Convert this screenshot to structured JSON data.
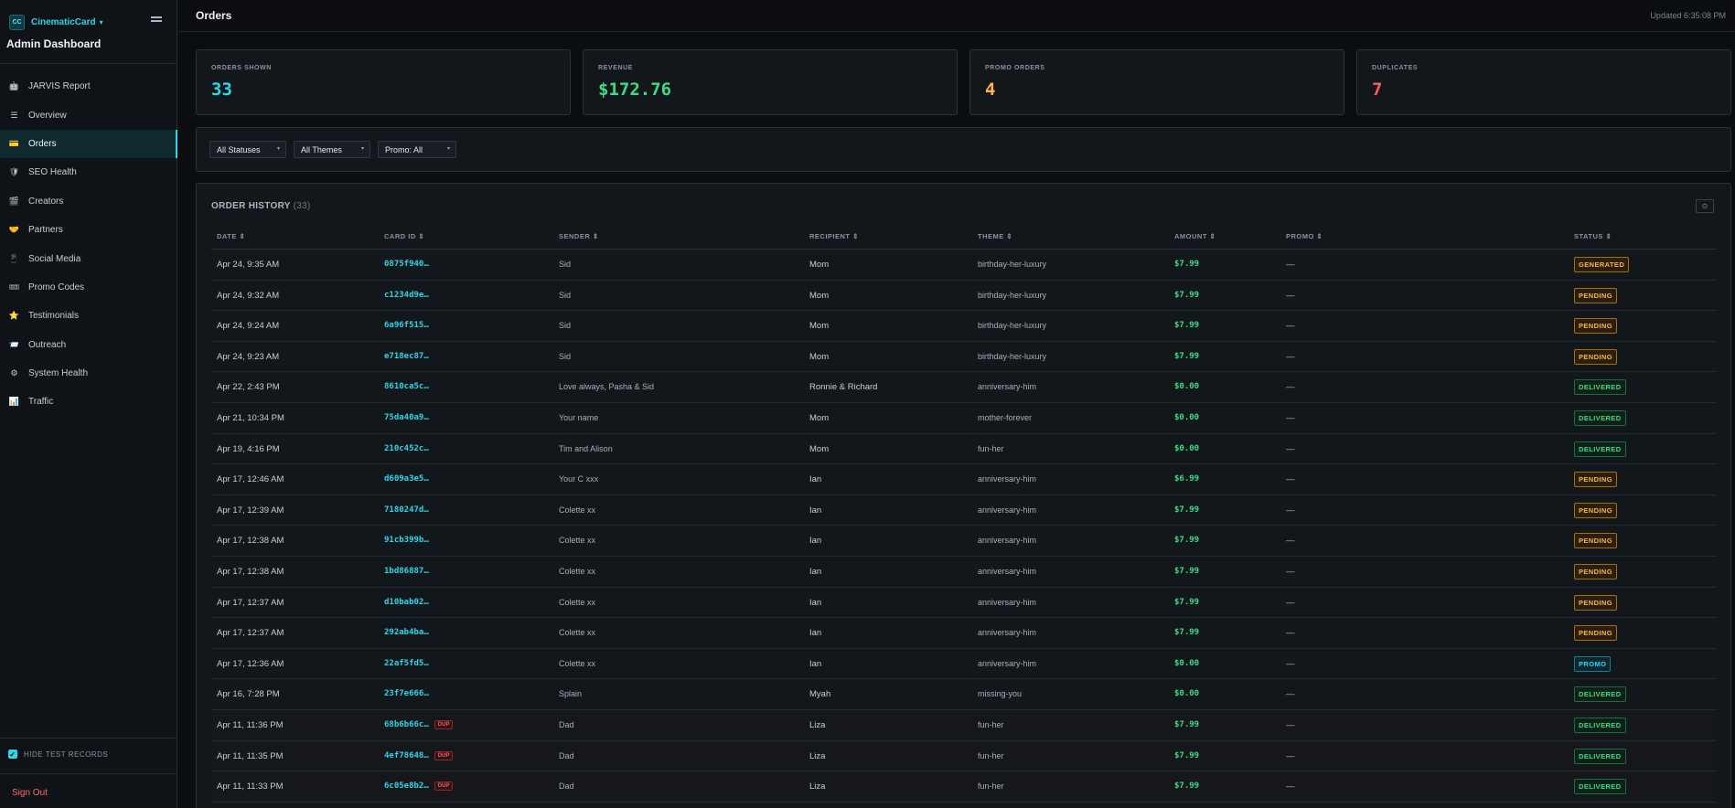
{
  "app": {
    "logo_text": "CC",
    "brand": "CinematicCard",
    "brand_caret": "▾",
    "subtitle": "Admin Dashboard"
  },
  "sidebar": {
    "items": [
      {
        "label": "JARVIS Report",
        "icon": "🤖",
        "icon_name": "robot-icon",
        "active": false
      },
      {
        "label": "Overview",
        "icon": "☰",
        "icon_name": "list-icon",
        "active": false
      },
      {
        "label": "Orders",
        "icon": "💳",
        "icon_name": "card-icon",
        "active": true
      },
      {
        "label": "SEO Health",
        "icon": "🛡",
        "icon_name": "shield-icon",
        "active": false
      },
      {
        "label": "Creators",
        "icon": "🎬",
        "icon_name": "clapper-icon",
        "active": false
      },
      {
        "label": "Partners",
        "icon": "🤝",
        "icon_name": "handshake-icon",
        "active": false
      },
      {
        "label": "Social Media",
        "icon": "📱",
        "icon_name": "phone-icon",
        "active": false
      },
      {
        "label": "Promo Codes",
        "icon": "🎟",
        "icon_name": "ticket-icon",
        "active": false
      },
      {
        "label": "Testimonials",
        "icon": "⭐",
        "icon_name": "star-icon",
        "active": false
      },
      {
        "label": "Outreach",
        "icon": "📨",
        "icon_name": "envelope-icon",
        "active": false
      },
      {
        "label": "System Health",
        "icon": "⚙",
        "icon_name": "gear-icon",
        "active": false
      },
      {
        "label": "Traffic",
        "icon": "📊",
        "icon_name": "chart-icon",
        "active": false
      }
    ],
    "hide_test_label": "HIDE TEST RECORDS",
    "hide_test_checked": true,
    "sign_out": "Sign Out"
  },
  "header": {
    "title": "Orders",
    "updated": "Updated 6:35:08 PM"
  },
  "stats": [
    {
      "label": "ORDERS SHOWN",
      "value": "33",
      "color": "#2fd6e8"
    },
    {
      "label": "REVENUE",
      "value": "$172.76",
      "color": "#3ddc84"
    },
    {
      "label": "PROMO ORDERS",
      "value": "4",
      "color": "#ffb347"
    },
    {
      "label": "DUPLICATES",
      "value": "7",
      "color": "#ff5a5a"
    }
  ],
  "filters": {
    "status": "All Statuses",
    "theme": "All Themes",
    "promo": "Promo: All"
  },
  "order_history": {
    "title": "ORDER HISTORY",
    "count": "(33)",
    "columns": [
      "DATE ⇕",
      "CARD ID ⇕",
      "SENDER ⇕",
      "RECIPIENT ⇕",
      "THEME ⇕",
      "AMOUNT ⇕",
      "PROMO ⇕",
      "STATUS ⇕"
    ],
    "dup_label": "DUP",
    "rows": [
      {
        "date": "Apr 24, 9:35 AM",
        "card": "0875f940…",
        "sender": "Sid",
        "recipient": "Mom",
        "theme": "birthday-her-luxury",
        "amount": "$7.99",
        "promo": "—",
        "status": "GENERATED",
        "dup": false
      },
      {
        "date": "Apr 24, 9:32 AM",
        "card": "c1234d9e…",
        "sender": "Sid",
        "recipient": "Mom",
        "theme": "birthday-her-luxury",
        "amount": "$7.99",
        "promo": "—",
        "status": "PENDING",
        "dup": false
      },
      {
        "date": "Apr 24, 9:24 AM",
        "card": "6a96f515…",
        "sender": "Sid",
        "recipient": "Mom",
        "theme": "birthday-her-luxury",
        "amount": "$7.99",
        "promo": "—",
        "status": "PENDING",
        "dup": false
      },
      {
        "date": "Apr 24, 9:23 AM",
        "card": "e718ec87…",
        "sender": "Sid",
        "recipient": "Mom",
        "theme": "birthday-her-luxury",
        "amount": "$7.99",
        "promo": "—",
        "status": "PENDING",
        "dup": false
      },
      {
        "date": "Apr 22, 2:43 PM",
        "card": "8610ca5c…",
        "sender": "Love always, Pasha & Sid",
        "recipient": "Ronnie & Richard",
        "theme": "anniversary-him",
        "amount": "$0.00",
        "promo": "—",
        "status": "DELIVERED",
        "dup": false
      },
      {
        "date": "Apr 21, 10:34 PM",
        "card": "75da40a9…",
        "sender": "Your name",
        "recipient": "Mom",
        "theme": "mother-forever",
        "amount": "$0.00",
        "promo": "—",
        "status": "DELIVERED",
        "dup": false
      },
      {
        "date": "Apr 19, 4:16 PM",
        "card": "210c452c…",
        "sender": "Tim and Alison",
        "recipient": "Mom",
        "theme": "fun-her",
        "amount": "$0.00",
        "promo": "—",
        "status": "DELIVERED",
        "dup": false
      },
      {
        "date": "Apr 17, 12:46 AM",
        "card": "d609a3e5…",
        "sender": "Your C xxx",
        "recipient": "Ian",
        "theme": "anniversary-him",
        "amount": "$6.99",
        "promo": "—",
        "status": "PENDING",
        "dup": false
      },
      {
        "date": "Apr 17, 12:39 AM",
        "card": "7180247d…",
        "sender": "Colette xx",
        "recipient": "Ian",
        "theme": "anniversary-him",
        "amount": "$7.99",
        "promo": "—",
        "status": "PENDING",
        "dup": false
      },
      {
        "date": "Apr 17, 12:38 AM",
        "card": "91cb399b…",
        "sender": "Colette xx",
        "recipient": "Ian",
        "theme": "anniversary-him",
        "amount": "$7.99",
        "promo": "—",
        "status": "PENDING",
        "dup": false
      },
      {
        "date": "Apr 17, 12:38 AM",
        "card": "1bd86887…",
        "sender": "Colette xx",
        "recipient": "Ian",
        "theme": "anniversary-him",
        "amount": "$7.99",
        "promo": "—",
        "status": "PENDING",
        "dup": false
      },
      {
        "date": "Apr 17, 12:37 AM",
        "card": "d10bab02…",
        "sender": "Colette xx",
        "recipient": "Ian",
        "theme": "anniversary-him",
        "amount": "$7.99",
        "promo": "—",
        "status": "PENDING",
        "dup": false
      },
      {
        "date": "Apr 17, 12:37 AM",
        "card": "292ab4ba…",
        "sender": "Colette xx",
        "recipient": "Ian",
        "theme": "anniversary-him",
        "amount": "$7.99",
        "promo": "—",
        "status": "PENDING",
        "dup": false
      },
      {
        "date": "Apr 17, 12:36 AM",
        "card": "22af5fd5…",
        "sender": "Colette xx",
        "recipient": "Ian",
        "theme": "anniversary-him",
        "amount": "$0.00",
        "promo": "—",
        "status": "PROMO",
        "dup": false
      },
      {
        "date": "Apr 16, 7:28 PM",
        "card": "23f7e666…",
        "sender": "Splain",
        "recipient": "Myah",
        "theme": "missing-you",
        "amount": "$0.00",
        "promo": "—",
        "status": "DELIVERED",
        "dup": false
      },
      {
        "date": "Apr 11, 11:36 PM",
        "card": "68b6b66c…",
        "sender": "Dad",
        "recipient": "Liza",
        "theme": "fun-her",
        "amount": "$7.99",
        "promo": "—",
        "status": "DELIVERED",
        "dup": true
      },
      {
        "date": "Apr 11, 11:35 PM",
        "card": "4ef78648…",
        "sender": "Dad",
        "recipient": "Liza",
        "theme": "fun-her",
        "amount": "$7.99",
        "promo": "—",
        "status": "DELIVERED",
        "dup": true
      },
      {
        "date": "Apr 11, 11:33 PM",
        "card": "6c05e8b2…",
        "sender": "Dad",
        "recipient": "Liza",
        "theme": "fun-her",
        "amount": "$7.99",
        "promo": "—",
        "status": "DELIVERED",
        "dup": true
      }
    ]
  }
}
